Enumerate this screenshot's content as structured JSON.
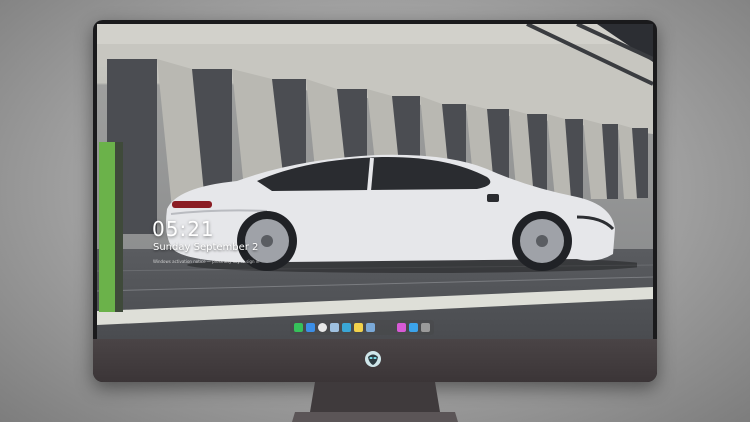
{
  "lock_screen": {
    "time": "05:21",
    "date": "Sunday September 2",
    "notice": "Windows activation notice — press any key to sign in"
  },
  "dock": {
    "apps": [
      {
        "icon": "messages-icon",
        "color": "#36c15a"
      },
      {
        "icon": "finder-icon",
        "color": "#3b8ee6"
      },
      {
        "icon": "clock-icon",
        "color": "#e8e8e8"
      },
      {
        "icon": "preview-icon",
        "color": "#9fc1e0"
      },
      {
        "icon": "clapper-icon",
        "color": "#3aa7d6"
      },
      {
        "icon": "notes-icon",
        "color": "#f2d24b"
      },
      {
        "icon": "photos-icon",
        "color": "#7aa9d8"
      },
      {
        "icon": "itunes-icon",
        "color": "#d85ad6"
      },
      {
        "icon": "appstore-icon",
        "color": "#3ba3ea"
      },
      {
        "icon": "camera-icon",
        "color": "#9a9a9a"
      }
    ]
  }
}
